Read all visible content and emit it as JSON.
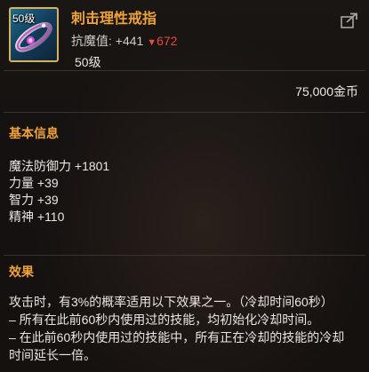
{
  "item": {
    "level_badge": "50级",
    "name": "刺击理性戒指",
    "stat_label": "抗魔值:",
    "stat_up": "+441",
    "stat_down": "672",
    "required_level": "50级",
    "icon": "ring-icon"
  },
  "price": "75,000金币",
  "basic_info": {
    "title": "基本信息",
    "attributes": [
      "魔法防御力 +1801",
      "力量 +39",
      "智力 +39",
      "精神 +110"
    ]
  },
  "effect": {
    "title": "效果",
    "lines": [
      "攻击时，有3%的概率适用以下效果之一。（冷却时间60秒）",
      "– 所有在此前60秒内使用过的技能，均初始化冷却时间。",
      "– 在此前60秒内使用过的技能中，所有正在冷却的技能的冷却",
      "时间延长一倍。"
    ]
  },
  "colors": {
    "title_orange": "#f0a23b",
    "down_red": "#e84b3c",
    "frame_gold": "#d7b25a"
  }
}
